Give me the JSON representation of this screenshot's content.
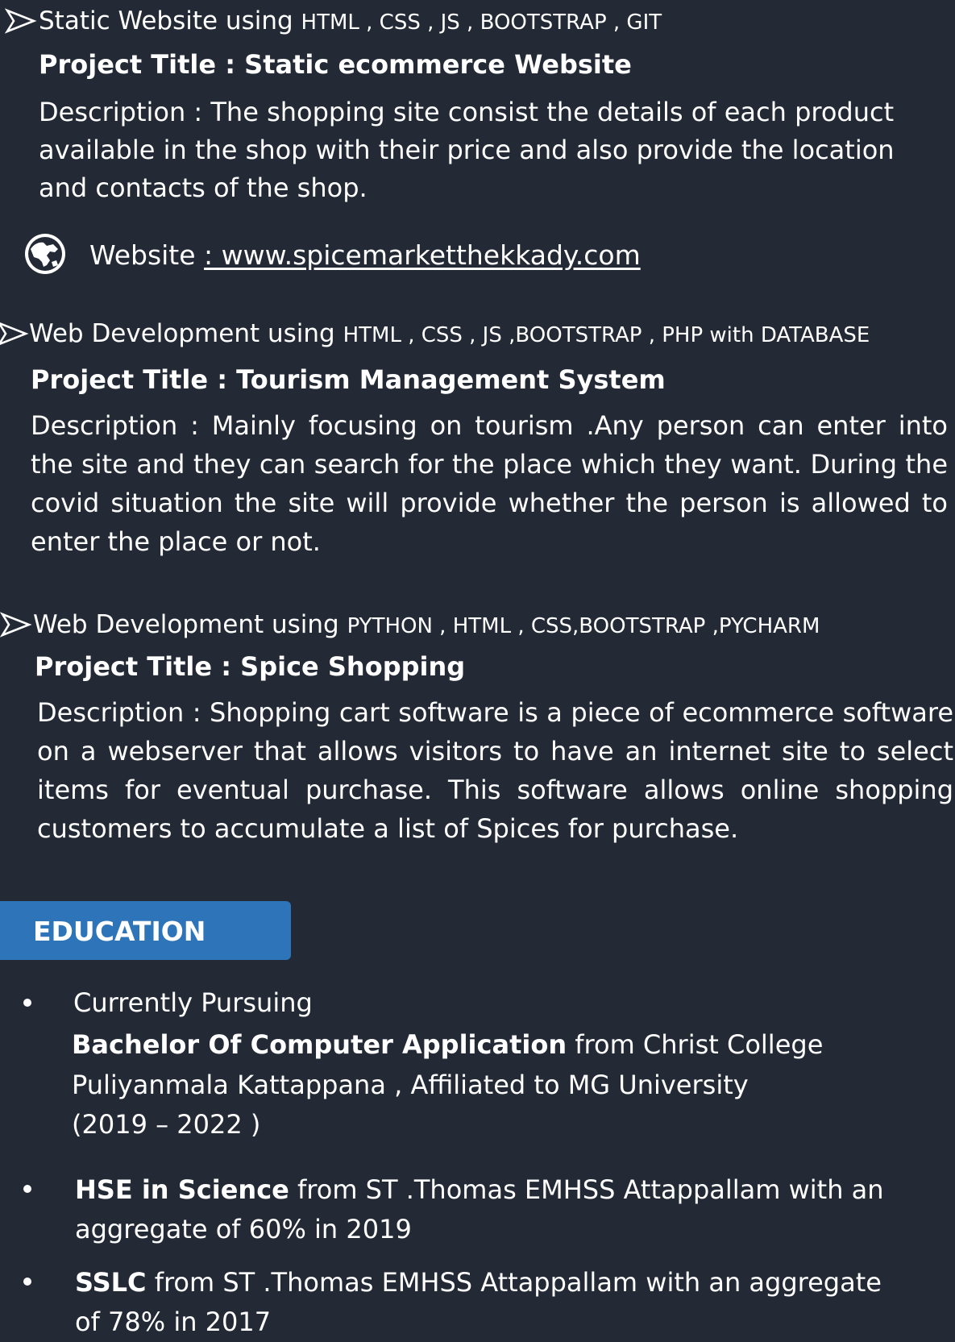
{
  "projects": [
    {
      "heading_main": "Static Website using ",
      "heading_tech": "HTML , CSS , JS ,  BOOTSTRAP , GIT",
      "title": "Project Title : Static ecommerce Website",
      "description": [
        "Description  : The shopping site consist the details of each product",
        "available in the shop with their price and also provide the location",
        "and contacts of the shop."
      ],
      "website_label": "Website ",
      "website_url": ": www.spicemarketthekkady.com "
    },
    {
      "heading_main": "Web Development  using  ",
      "heading_tech": "HTML , CSS , JS ,BOOTSTRAP , PHP with DATABASE",
      "title": "Project Title : Tourism Management System",
      "description": "Description   : Mainly focusing on tourism .Any person can enter into the site and they can search for the place which they want. During the covid situation the site will provide whether the person  is allowed to enter the place or not."
    },
    {
      "heading_main": "Web Development using ",
      "heading_tech": "PYTHON , HTML , CSS,BOOTSTRAP ,PYCHARM",
      "title": "Project Title    :  Spice Shopping",
      "description": "Description    : Shopping cart software is a piece of ecommerce software on a webserver that allows visitors to have an internet site to select items for eventual purchase. This software allows online shopping customers to accumulate a list of Spices for purchase."
    }
  ],
  "education": {
    "heading": "EDUCATION",
    "items": [
      {
        "lead": "Currently Pursuing",
        "bold": "Bachelor Of Computer Application",
        "rest": " from Christ College",
        "line2": "Puliyanmala Kattappana , Affiliated to MG University",
        "line3": "(2019 – 2022 )"
      },
      {
        "bold": "HSE in Science",
        "rest": " from ST .Thomas EMHSS Attappallam with an",
        "line2": "aggregate of 60% in 2019"
      },
      {
        "bold": "SSLC",
        "rest": " from ST .Thomas EMHSS Attappallam with an aggregate",
        "line2": "of 78%  in  2017"
      }
    ]
  },
  "icons": [
    "arrow-bullet-icon",
    "globe-icon"
  ],
  "colors": {
    "background": "#232a35",
    "accent": "#2e74b8",
    "text": "#ffffff"
  }
}
